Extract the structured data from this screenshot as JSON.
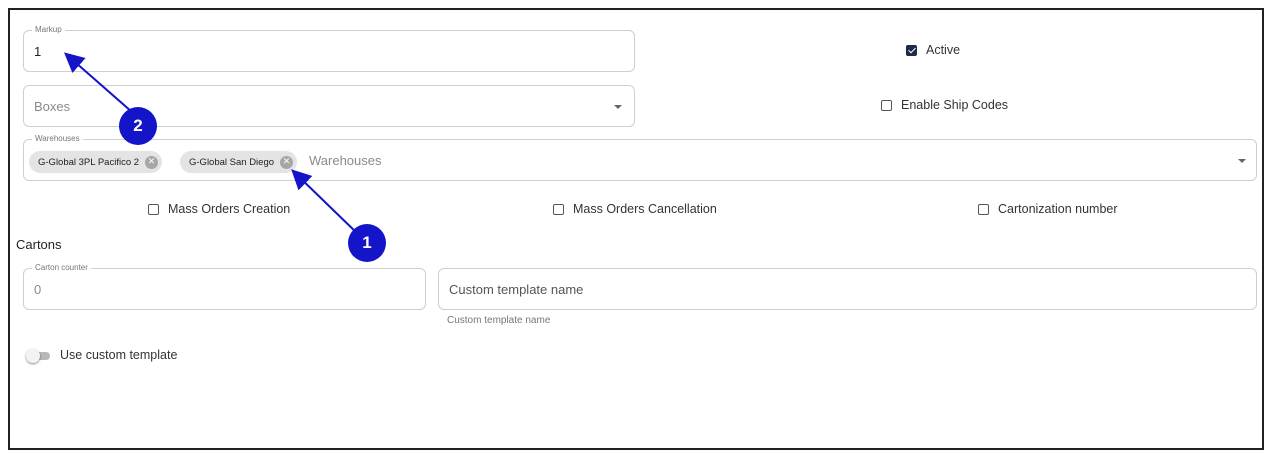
{
  "form": {
    "markup": {
      "label": "Markup",
      "value": "1"
    },
    "active": {
      "label": "Active",
      "checked": true
    },
    "boxes": {
      "placeholder": "Boxes"
    },
    "enable_ship_codes": {
      "label": "Enable Ship Codes",
      "checked": false
    },
    "warehouses": {
      "label": "Warehouses",
      "chips": [
        "G-Global 3PL Pacifico 2",
        "G-Global San Diego"
      ],
      "placeholder": "Warehouses"
    },
    "mass_orders_creation": {
      "label": "Mass Orders Creation",
      "checked": false
    },
    "mass_orders_cancellation": {
      "label": "Mass Orders Cancellation",
      "checked": false
    },
    "cartonization_number": {
      "label": "Cartonization number",
      "checked": false
    }
  },
  "cartons": {
    "title": "Cartons",
    "carton_counter": {
      "label": "Carton counter",
      "value": "0"
    },
    "custom_template_name": {
      "placeholder": "Custom template name",
      "helper": "Custom template name"
    },
    "use_custom_template": {
      "label": "Use custom template",
      "enabled": false
    }
  },
  "annotations": {
    "marker_1": "1",
    "marker_2": "2",
    "color": "#1414c8"
  },
  "icons": {
    "chip_remove": "close-circle-icon",
    "dropdown": "chevron-down-icon",
    "checkbox": "checkbox-icon"
  },
  "colors": {
    "checkbox_checked": "#1c2b4a",
    "border": "#cfcfcf",
    "chip_bg": "#e4e4e4"
  }
}
